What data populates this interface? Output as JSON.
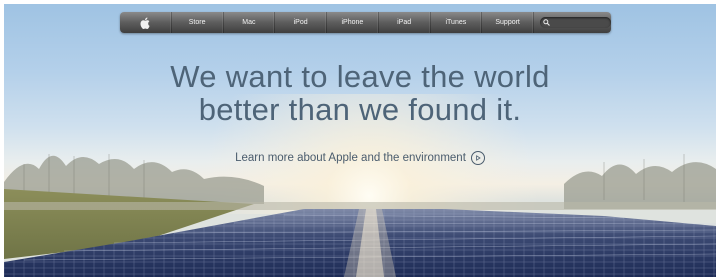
{
  "nav": {
    "logo_icon": "apple-logo-icon",
    "items": [
      {
        "label": "Store"
      },
      {
        "label": "Mac"
      },
      {
        "label": "iPod"
      },
      {
        "label": "iPhone"
      },
      {
        "label": "iPad"
      },
      {
        "label": "iTunes"
      },
      {
        "label": "Support"
      }
    ],
    "search": {
      "icon": "search-icon",
      "placeholder": ""
    }
  },
  "hero": {
    "headline_line1": "We want to leave the world",
    "headline_line2": "better than we found it.",
    "cta_label": "Learn more about Apple and the environment",
    "cta_icon": "play-circle-icon",
    "image_subject": "solar panel field at sunrise"
  },
  "colors": {
    "nav_bg": "#5d5d5d",
    "headline": "#4e6478",
    "sky_top": "#9fc3e3"
  }
}
